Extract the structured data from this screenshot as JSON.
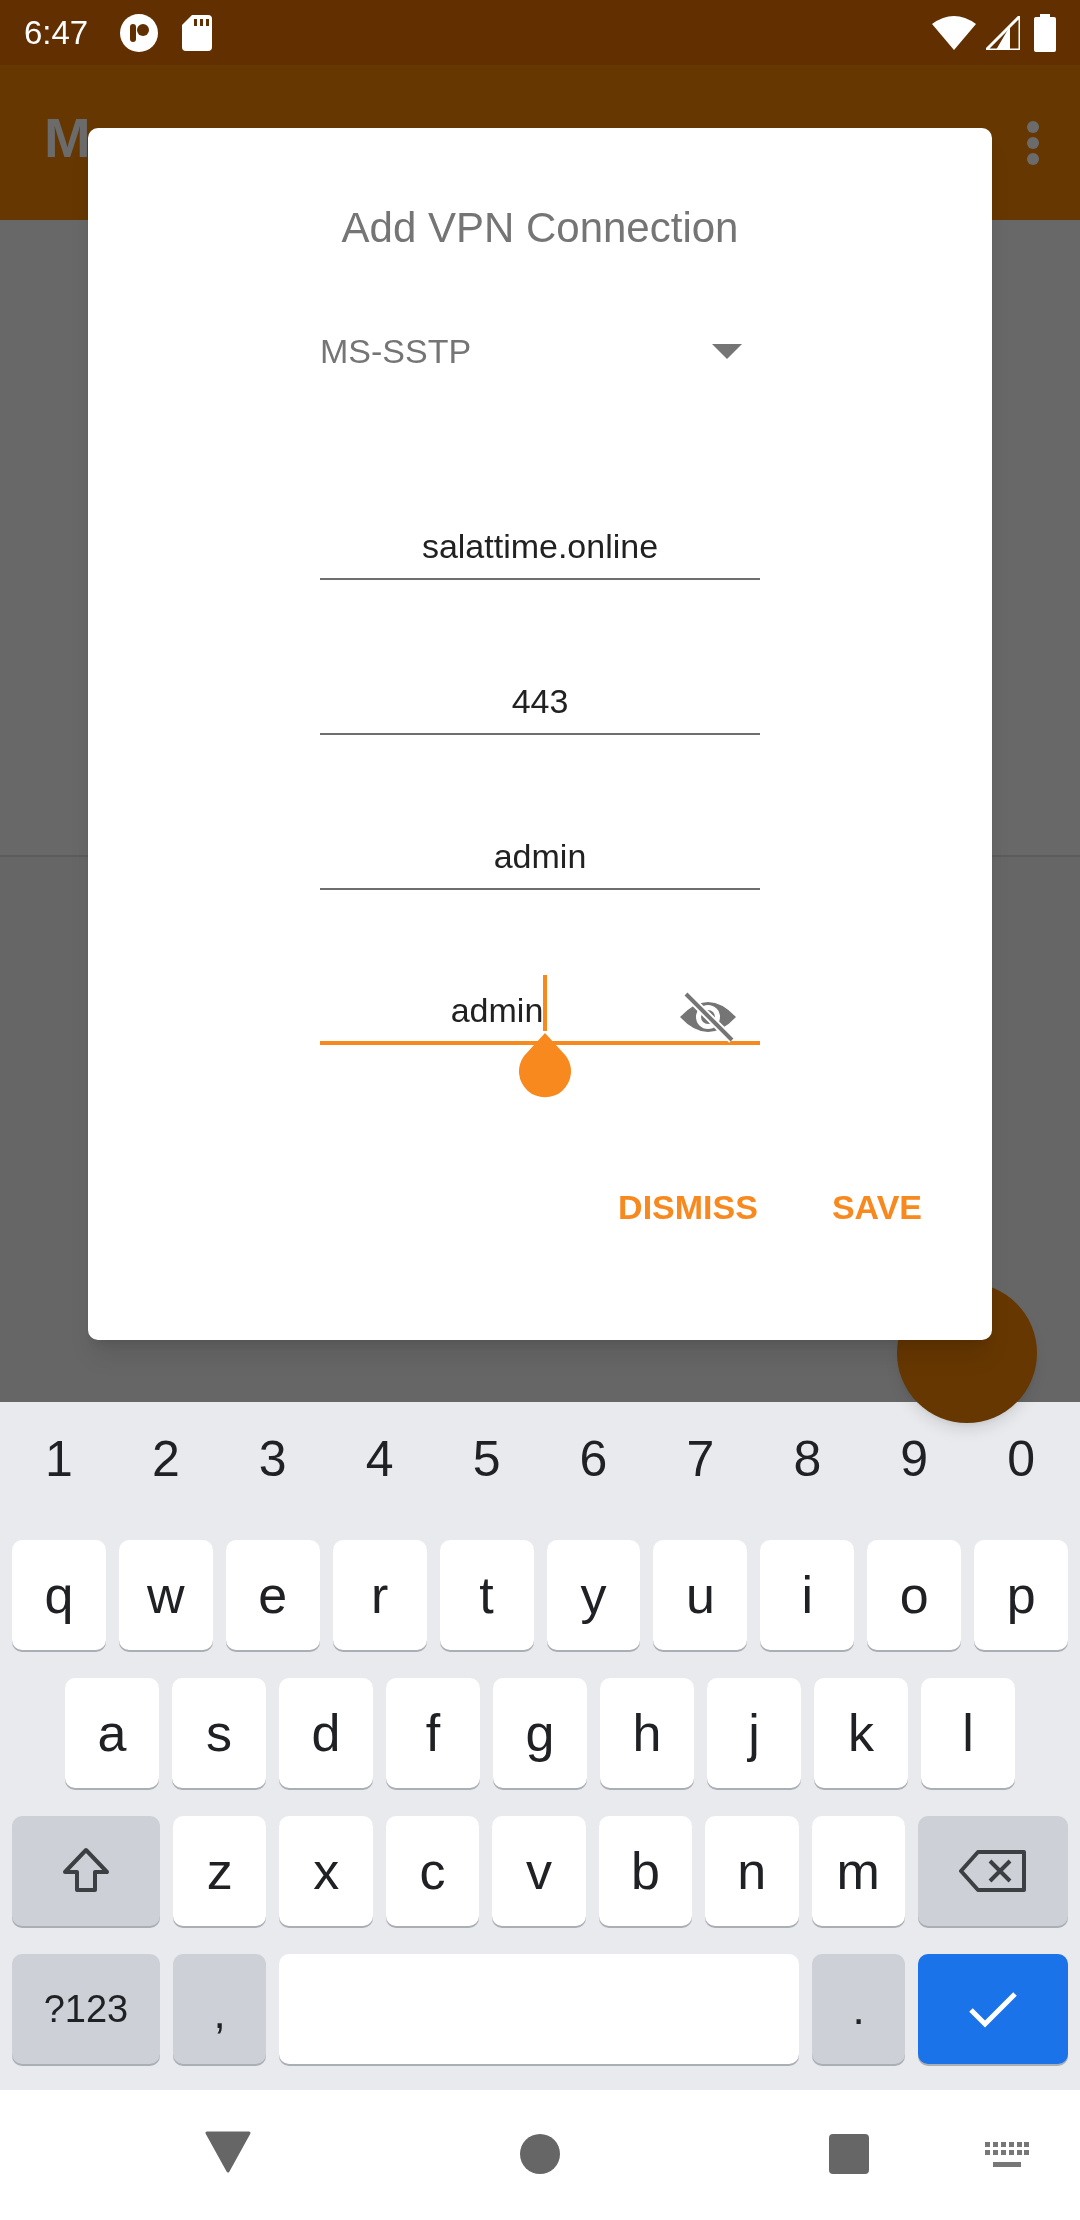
{
  "status_bar": {
    "time": "6:47"
  },
  "app_bar": {
    "title": "M"
  },
  "dialog": {
    "title": "Add VPN Connection",
    "spinner": {
      "value": "MS-SSTP"
    },
    "fields": [
      {
        "kind": "text",
        "value": "salattime.online",
        "focused": false
      },
      {
        "kind": "text",
        "value": "443",
        "focused": false
      },
      {
        "kind": "text",
        "value": "admin",
        "focused": false
      },
      {
        "kind": "password",
        "value": "admin",
        "focused": true
      }
    ],
    "buttons": [
      "DISMISS",
      "SAVE"
    ]
  },
  "keyboard": {
    "number_row": [
      "1",
      "2",
      "3",
      "4",
      "5",
      "6",
      "7",
      "8",
      "9",
      "0"
    ],
    "rows": [
      [
        "q",
        "w",
        "e",
        "r",
        "t",
        "y",
        "u",
        "i",
        "o",
        "p"
      ],
      [
        "a",
        "s",
        "d",
        "f",
        "g",
        "h",
        "j",
        "k",
        "l"
      ],
      [
        "z",
        "x",
        "c",
        "v",
        "b",
        "n",
        "m"
      ]
    ],
    "symbols_key": "?123",
    "comma_key": ",",
    "period_key": "."
  }
}
